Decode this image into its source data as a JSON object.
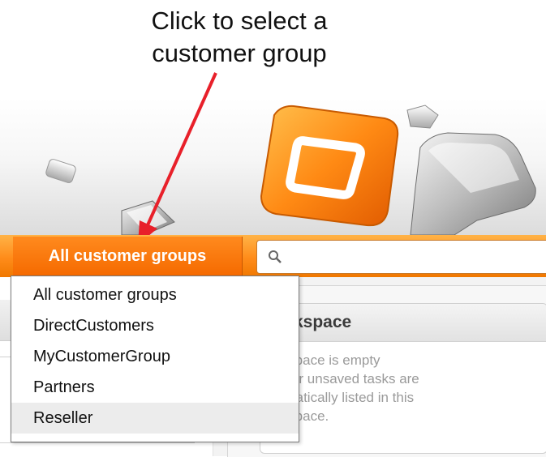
{
  "callout": {
    "line1": "Click to select a",
    "line2": "customer group"
  },
  "toolbar": {
    "group_button_label": "All customer groups",
    "search_placeholder": ""
  },
  "dropdown": {
    "options": [
      "All customer groups",
      "DirectCustomers",
      "MyCustomerGroup",
      "Partners",
      "Reseller"
    ],
    "highlighted": "Reseller"
  },
  "workspace": {
    "title": "orkspace",
    "lines": [
      "rkspace is empty",
      "your unsaved tasks are",
      "omatically listed in this",
      "rkspace."
    ]
  },
  "colors": {
    "accent_orange": "#f56a00",
    "arrow_red": "#e8202a",
    "toolbar_orange": "#ff8c1a"
  }
}
